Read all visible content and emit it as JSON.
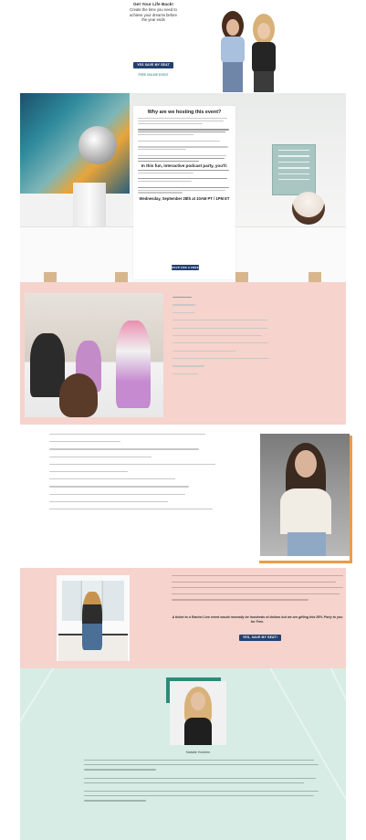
{
  "hero": {
    "title": "Get Your Life Back!",
    "subtitle_line1": "Create the time you need to",
    "subtitle_line2": "achieve your dreams before",
    "subtitle_line3": "the year ends",
    "save_button": "YES SAVE MY SEAT",
    "free_link": "FREE ONLINE EVENT"
  },
  "event": {
    "title": "Why are we hosting this event?",
    "party_heading": "In this fun, interactive podcast party, you'll:",
    "date": "Wednesday, September 28th at 10AM PT / 1PM ET",
    "party_button": "RSVP FOR A FREE SEAT"
  },
  "offer": {
    "emphasis": "A ticket to a Rachel Live event would normally be hundreds of dollars but we are gifting this 85% Party to you for Free.",
    "save_button": "YES, SAVE MY SEAT!"
  },
  "host": {
    "name": "Natalie Holdren"
  }
}
